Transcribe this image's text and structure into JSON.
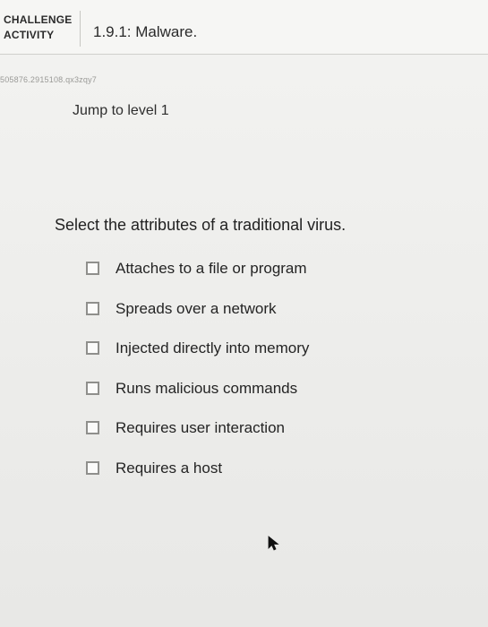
{
  "header": {
    "badge_line1": "CHALLENGE",
    "badge_line2": "ACTIVITY",
    "title": "1.9.1: Malware."
  },
  "activity_id": "505876.2915108.qx3zqy7",
  "jump_link": "Jump to level 1",
  "question": {
    "prompt": "Select the attributes of a traditional virus.",
    "options": [
      {
        "label": "Attaches to a file or program",
        "checked": false
      },
      {
        "label": "Spreads over a network",
        "checked": false
      },
      {
        "label": "Injected directly into memory",
        "checked": false
      },
      {
        "label": "Runs malicious commands",
        "checked": false
      },
      {
        "label": "Requires user interaction",
        "checked": false
      },
      {
        "label": "Requires a host",
        "checked": false
      }
    ]
  },
  "icons": {
    "cursor": "mouse-pointer-icon"
  }
}
